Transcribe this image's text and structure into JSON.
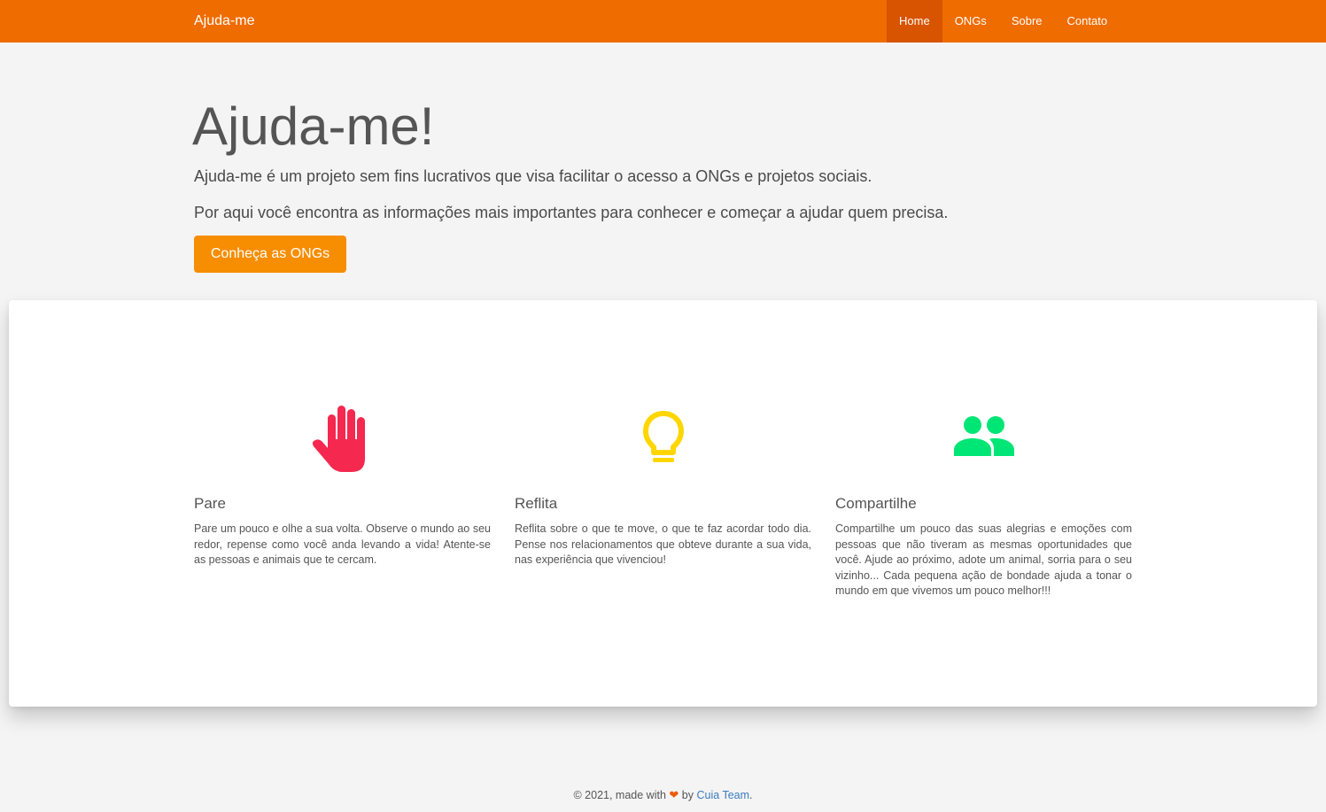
{
  "navbar": {
    "brand": "Ajuda-me",
    "items": [
      {
        "label": "Home",
        "active": true
      },
      {
        "label": "ONGs",
        "active": false
      },
      {
        "label": "Sobre",
        "active": false
      },
      {
        "label": "Contato",
        "active": false
      }
    ],
    "color": "#ef6c00"
  },
  "hero": {
    "title": "Ajuda-me!",
    "paragraph1": "Ajuda-me é um projeto sem fins lucrativos que visa facilitar o acesso a ONGs e projetos sociais.",
    "paragraph2": "Por aqui você encontra as informações mais importantes para conhecer e começar a ajudar quem precisa.",
    "cta_label": "Conheça as ONGs"
  },
  "features": [
    {
      "icon": "hand-stop-icon",
      "icon_color": "#f5284f",
      "title": "Pare",
      "text": "Pare um pouco e olhe a sua volta. Observe o mundo ao seu redor, repense como você anda levando a vida! Atente-se as pessoas e animais que te cercam."
    },
    {
      "icon": "lightbulb-icon",
      "icon_color": "#ffd600",
      "title": "Reflita",
      "text": "Reflita sobre o que te move, o que te faz acordar todo dia. Pense nos relacionamentos que obteve durante a sua vida, nas experiência que vivenciou!"
    },
    {
      "icon": "people-icon",
      "icon_color": "#00e676",
      "title": "Compartilhe",
      "text": "Compartilhe um pouco das suas alegrias e emoções com pessoas que não tiveram as mesmas oportunidades que você. Ajude ao próximo, adote um animal, sorria para o seu vizinho... Cada pequena ação de bondade ajuda a tonar o mundo em que vivemos um pouco melhor!!!"
    }
  ],
  "footer": {
    "prefix": "© 2021, made with",
    "heart": "❤",
    "by": "by",
    "team": "Cuia Team",
    "suffix": "."
  }
}
